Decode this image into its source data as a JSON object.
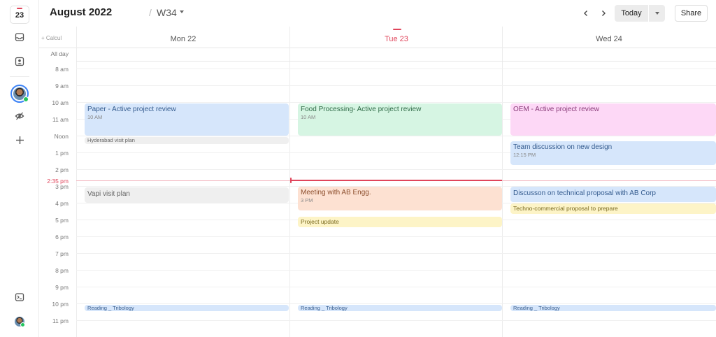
{
  "rail": {
    "calendar_day": "23"
  },
  "header": {
    "month": "August 2022",
    "separator": "/",
    "week": "W34",
    "today_label": "Today",
    "share_label": "Share"
  },
  "dayrow": {
    "calc_label": "+ Calcul",
    "days": [
      {
        "label": "Mon 22"
      },
      {
        "label": "Tue 23"
      },
      {
        "label": "Wed 24"
      }
    ]
  },
  "grid": {
    "allday_label": "All day",
    "hours": [
      "8 am",
      "9 am",
      "10 am",
      "11 am",
      "Noon",
      "1 pm",
      "2 pm",
      "3 pm",
      "4 pm",
      "5 pm",
      "6 pm",
      "7 pm",
      "8 pm",
      "9 pm",
      "10 pm",
      "11 pm"
    ],
    "now_label": "2:35 pm"
  },
  "events": {
    "mon_paper": {
      "title": "Paper - Active project review",
      "time": "10 AM"
    },
    "mon_hyderabad": {
      "title": "Hyderabad visit plan"
    },
    "mon_vapi": {
      "title": "Vapi visit plan"
    },
    "mon_reading": {
      "title": "Reading _ Tribology"
    },
    "tue_food": {
      "title": "Food Processing- Active project review",
      "time": "10 AM"
    },
    "tue_meeting": {
      "title": "Meeting with AB Engg.",
      "time": "3 PM"
    },
    "tue_project": {
      "title": "Project update"
    },
    "tue_reading": {
      "title": "Reading _ Tribology"
    },
    "wed_oem": {
      "title": "OEM - Active project review"
    },
    "wed_team": {
      "title": "Team discussion on new design",
      "time": "12:15 PM"
    },
    "wed_discussion": {
      "title": "Discusson on technical proposal with AB Corp"
    },
    "wed_techno": {
      "title": "Techno-commercial proposal to prepare"
    },
    "wed_reading": {
      "title": "Reading _ Tribology"
    }
  },
  "colors": {
    "accent_today": "#e0455b",
    "event_blue": "#d6e6fb",
    "event_green": "#d6f5e3",
    "event_pink": "#fdd8f6",
    "event_gray": "#efefef",
    "event_peach": "#fde1d2",
    "event_yellow": "#fdf4c7"
  },
  "icons": [
    "calendar-icon",
    "inbox-icon",
    "contacts-icon",
    "hide-icon",
    "plus-icon",
    "terminal-icon",
    "chevron-left-icon",
    "chevron-right-icon",
    "chevron-down-icon"
  ]
}
